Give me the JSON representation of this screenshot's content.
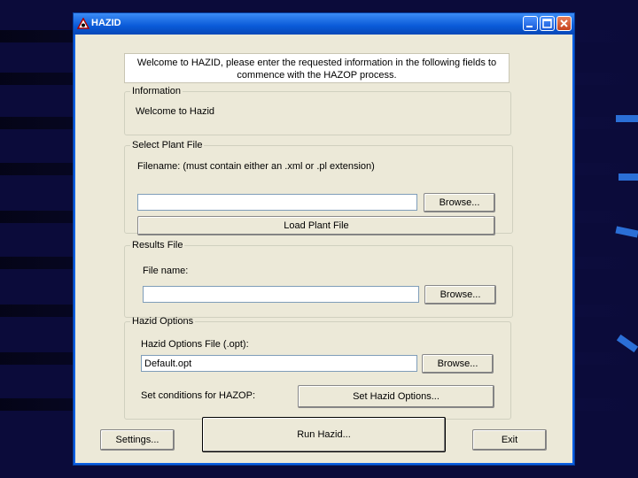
{
  "window": {
    "title": "HAZID"
  },
  "intro": {
    "text": "Welcome to HAZID, please enter the requested information in the following fields to commence with the HAZOP process."
  },
  "information": {
    "legend": "Information",
    "text": "Welcome to Hazid"
  },
  "plant_file": {
    "legend": "Select Plant File",
    "label": "Filename: (must contain either an .xml or .pl extension)",
    "value": "",
    "browse": "Browse...",
    "load": "Load Plant File"
  },
  "results_file": {
    "legend": "Results File",
    "label": "File name:",
    "value": "",
    "browse": "Browse..."
  },
  "hazid_options": {
    "legend": "Hazid Options",
    "label": "Hazid Options File (.opt):",
    "value": "Default.opt",
    "browse": "Browse...",
    "conditions_label": "Set conditions for HAZOP:",
    "set_options": "Set Hazid Options..."
  },
  "footer": {
    "settings": "Settings...",
    "run": "Run Hazid...",
    "exit": "Exit"
  },
  "colors": {
    "titlebar": "#0a5ad8",
    "client": "#ece9d8",
    "desktop": "#0b0b3a"
  }
}
